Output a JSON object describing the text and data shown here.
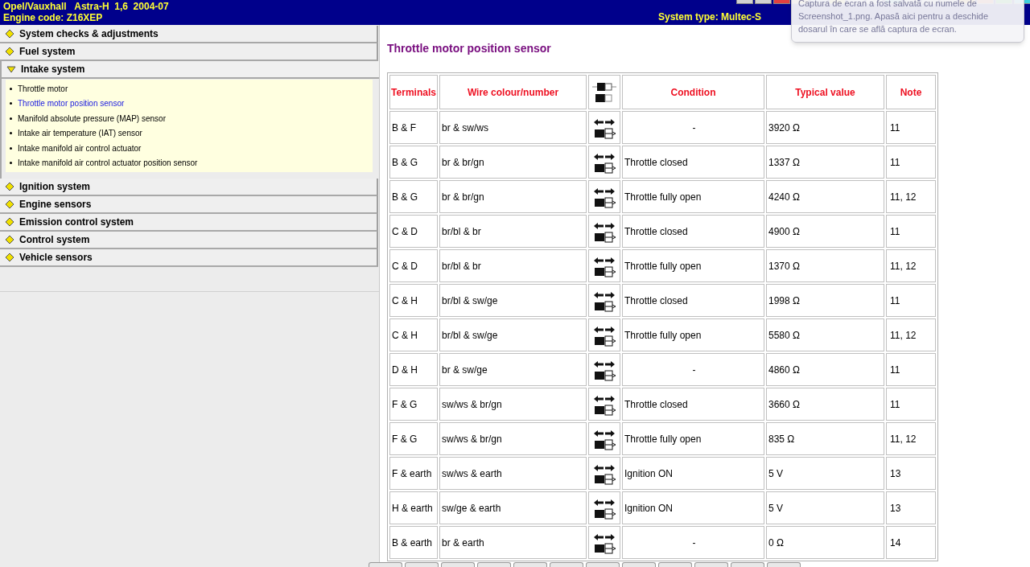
{
  "header": {
    "vehicle": "Opel/Vauxhall   Astra-H  1,6  2004-07",
    "engine_code": "Engine code: Z16XEP",
    "system_type": "System type: Multec-S"
  },
  "notification": {
    "text": "Captura de ecran a fost salvată cu numele de Screenshot_1.png. Apasă aici pentru a deschide dosarul în care se află captura de ecran."
  },
  "sidebar": {
    "items": [
      {
        "label": "System checks & adjustments",
        "expanded": false
      },
      {
        "label": "Fuel system",
        "expanded": false
      },
      {
        "label": "Intake system",
        "expanded": true,
        "children": [
          {
            "label": "Throttle motor",
            "selected": false
          },
          {
            "label": "Throttle motor position sensor",
            "selected": true
          },
          {
            "label": "Manifold absolute pressure (MAP) sensor",
            "selected": false
          },
          {
            "label": "Intake air temperature (IAT) sensor",
            "selected": false
          },
          {
            "label": "Intake manifold air control actuator",
            "selected": false
          },
          {
            "label": "Intake manifold air control actuator position sensor",
            "selected": false
          }
        ]
      },
      {
        "label": "Ignition system",
        "expanded": false
      },
      {
        "label": "Engine sensors",
        "expanded": false
      },
      {
        "label": "Emission control system",
        "expanded": false
      },
      {
        "label": "Control system",
        "expanded": false
      },
      {
        "label": "Vehicle sensors",
        "expanded": false
      }
    ]
  },
  "page_title": "Throttle motor position sensor",
  "table": {
    "columns": [
      "Terminals",
      "Wire colour/number",
      "Condition",
      "Typical value",
      "Note"
    ],
    "rows": [
      {
        "terminals": "B & F",
        "wire": "br & sw/ws",
        "condition": "-",
        "value": "3920 Ω",
        "note": "11"
      },
      {
        "terminals": "B & G",
        "wire": "br & br/gn",
        "condition": "Throttle closed",
        "value": "1337 Ω",
        "note": "11"
      },
      {
        "terminals": "B & G",
        "wire": "br & br/gn",
        "condition": "Throttle fully open",
        "value": "4240 Ω",
        "note": "11, 12"
      },
      {
        "terminals": "C & D",
        "wire": "br/bl & br",
        "condition": "Throttle closed",
        "value": "4900 Ω",
        "note": "11"
      },
      {
        "terminals": "C & D",
        "wire": "br/bl & br",
        "condition": "Throttle fully open",
        "value": "1370 Ω",
        "note": "11, 12"
      },
      {
        "terminals": "C & H",
        "wire": "br/bl & sw/ge",
        "condition": "Throttle closed",
        "value": "1998 Ω",
        "note": "11"
      },
      {
        "terminals": "C & H",
        "wire": "br/bl & sw/ge",
        "condition": "Throttle fully open",
        "value": "5580 Ω",
        "note": "11, 12"
      },
      {
        "terminals": "D & H",
        "wire": "br & sw/ge",
        "condition": "-",
        "value": "4860 Ω",
        "note": "11"
      },
      {
        "terminals": "F & G",
        "wire": "sw/ws & br/gn",
        "condition": "Throttle closed",
        "value": "3660 Ω",
        "note": "11"
      },
      {
        "terminals": "F & G",
        "wire": "sw/ws & br/gn",
        "condition": "Throttle fully open",
        "value": "835 Ω",
        "note": "11, 12"
      },
      {
        "terminals": "F & earth",
        "wire": "sw/ws & earth",
        "condition": "Ignition ON",
        "value": "5 V",
        "note": "13"
      },
      {
        "terminals": "H & earth",
        "wire": "sw/ge & earth",
        "condition": "Ignition ON",
        "value": "5 V",
        "note": "13"
      },
      {
        "terminals": "B & earth",
        "wire": "br & earth",
        "condition": "-",
        "value": "0 Ω",
        "note": "14"
      }
    ]
  }
}
